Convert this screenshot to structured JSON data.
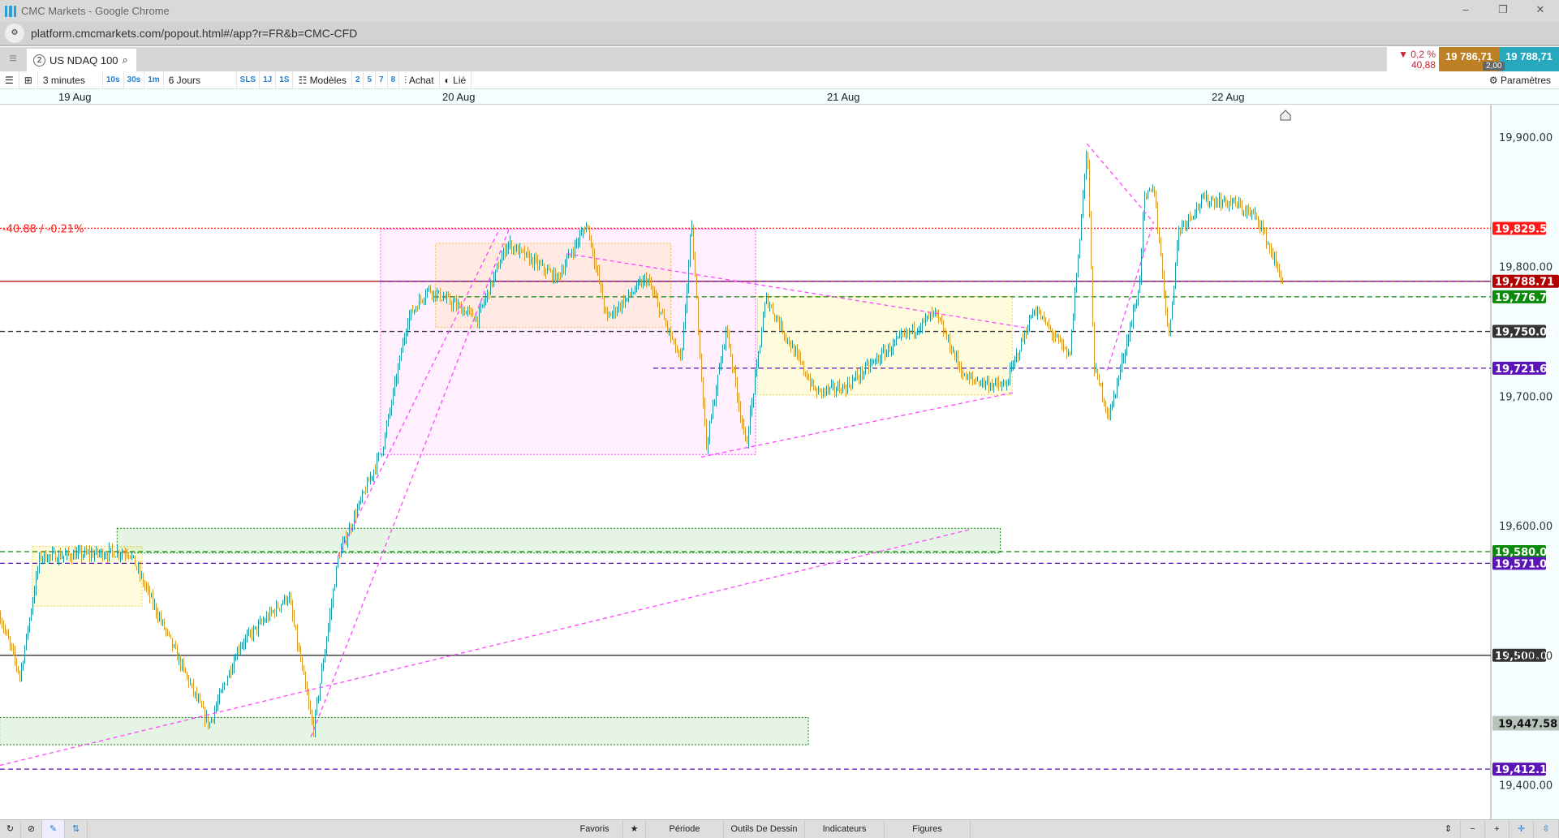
{
  "window": {
    "title": "CMC Markets - Google Chrome",
    "url": "platform.cmcmarkets.com/popout.html#/app?r=FR&b=CMC-CFD"
  },
  "tab": {
    "number": "2",
    "instrument": "US NDAQ 100"
  },
  "quote": {
    "change_pct": "▼ 0,2 %",
    "change_pts": "40,88",
    "sell": "19 786,71",
    "buy": "19 788,71",
    "spread": "2,00"
  },
  "toolbar": {
    "interval": "3 minutes",
    "quick_intervals": [
      "10s",
      "30s",
      "1m"
    ],
    "period": "6 Jours",
    "quick_periods": [
      "SLS",
      "1J",
      "1S"
    ],
    "templates": "Modèles",
    "template_slots": [
      "2",
      "5",
      "7",
      "8"
    ],
    "trade": "Achat",
    "linked": "Lié",
    "settings": "Paramètres"
  },
  "dates": [
    "19 Aug",
    "20 Aug",
    "21 Aug",
    "22 Aug"
  ],
  "bottom": {
    "favorites": "Favoris",
    "period": "Période",
    "drawing_tools": "Outils De Dessin",
    "indicators": "Indicateurs",
    "figures": "Figures"
  },
  "colors": {
    "up": "#1e9aa6",
    "down": "#d8982a",
    "accent": "#ff44ff"
  },
  "chart_data": {
    "type": "candlestick",
    "instrument": "US NDAQ 100",
    "timeframe": "3 minutes",
    "ylim": [
      19370,
      19925
    ],
    "x_unit": "days since 19 Aug (label)",
    "xlim": [
      -0.199,
      3.676
    ],
    "y_ticks": [
      "19,900.00",
      "19,800.00",
      "19,700.00",
      "19,600.00",
      "19,500.00",
      "19,400.00"
    ],
    "y_tick_values": [
      19900,
      19800,
      19700,
      19600,
      19500,
      19400
    ],
    "price_path": [
      [
        -0.199,
        19530
      ],
      [
        -0.147,
        19484
      ],
      [
        -0.096,
        19576
      ],
      [
        0.137,
        19580
      ],
      [
        0.189,
        19546
      ],
      [
        0.344,
        19446
      ],
      [
        0.422,
        19507
      ],
      [
        0.551,
        19546
      ],
      [
        0.615,
        19442
      ],
      [
        0.68,
        19576
      ],
      [
        0.796,
        19661
      ],
      [
        0.861,
        19760
      ],
      [
        0.913,
        19783
      ],
      [
        1.042,
        19760
      ],
      [
        1.12,
        19818
      ],
      [
        1.249,
        19791
      ],
      [
        1.327,
        19833
      ],
      [
        1.378,
        19760
      ],
      [
        1.482,
        19791
      ],
      [
        1.572,
        19726
      ],
      [
        1.598,
        19833
      ],
      [
        1.637,
        19661
      ],
      [
        1.689,
        19753
      ],
      [
        1.74,
        19661
      ],
      [
        1.792,
        19776
      ],
      [
        1.921,
        19703
      ],
      [
        1.999,
        19707
      ],
      [
        2.128,
        19741
      ],
      [
        2.232,
        19764
      ],
      [
        2.309,
        19714
      ],
      [
        2.413,
        19707
      ],
      [
        2.49,
        19768
      ],
      [
        2.581,
        19730
      ],
      [
        2.607,
        19822
      ],
      [
        2.627,
        19895
      ],
      [
        2.645,
        19722
      ],
      [
        2.684,
        19684
      ],
      [
        2.762,
        19783
      ],
      [
        2.775,
        19852
      ],
      [
        2.801,
        19860
      ],
      [
        2.839,
        19745
      ],
      [
        2.865,
        19829
      ],
      [
        2.93,
        19852
      ],
      [
        3.008,
        19849
      ],
      [
        3.072,
        19837
      ],
      [
        3.137,
        19787
      ]
    ],
    "levels": [
      {
        "value": 19829.59,
        "label": "19,829.59",
        "color": "#ff1a1a",
        "style": "dotted",
        "from": -0.199,
        "tag": "-40.88 / -0.21%"
      },
      {
        "value": 19788.71,
        "label": "19,788.71",
        "color": "#b00000",
        "style": "solid",
        "from": -0.199
      },
      {
        "value": 19788.71,
        "label": "",
        "color": "#5b14b8",
        "style": "dashed",
        "from": 0.79
      },
      {
        "value": 19776.71,
        "label": "19,776.71",
        "color": "#0a8a0a",
        "style": "dashed",
        "from": 0.93
      },
      {
        "value": 19750.0,
        "label": "19,750.00",
        "color": "#333333",
        "style": "dashed",
        "from": -0.199
      },
      {
        "value": 19721.62,
        "label": "19,721.62",
        "color": "#5b14b8",
        "style": "dashed",
        "from": 1.5
      },
      {
        "value": 19580.02,
        "label": "19,580.02",
        "color": "#0a8a0a",
        "style": "dashed",
        "from": -0.199
      },
      {
        "value": 19571.04,
        "label": "19,571.04",
        "color": "#5b14b8",
        "style": "dashed",
        "from": -0.199
      },
      {
        "value": 19500.0,
        "label": "19,500.00",
        "color": "#333333",
        "style": "solid",
        "from": -0.199
      },
      {
        "value": 19412.14,
        "label": "19,412.14",
        "color": "#5b14b8",
        "style": "dashed",
        "from": -0.199
      }
    ],
    "marker": {
      "value": 19447.58,
      "label": "19,447.58"
    },
    "zones": [
      {
        "t": [
          0.791,
          1.766
        ],
        "p": [
          19655,
          19829
        ],
        "color": "#ff44ff",
        "fill": "rgba(255,120,255,0.12)"
      },
      {
        "t": [
          0.934,
          1.546
        ],
        "p": [
          19753,
          19818
        ],
        "color": "#f0c040",
        "fill": "rgba(255,220,160,0.3)"
      },
      {
        "t": [
          1.771,
          2.433
        ],
        "p": [
          19701,
          19777
        ],
        "color": "#f0d040",
        "fill": "rgba(255,250,200,0.6)"
      },
      {
        "t": [
          -0.114,
          0.171
        ],
        "p": [
          19538,
          19584
        ],
        "color": "#f0d040",
        "fill": "rgba(255,250,200,0.6)"
      },
      {
        "t": [
          0.106,
          2.402
        ],
        "p": [
          19579,
          19598
        ],
        "color": "#0a8a0a",
        "fill": "rgba(60,170,60,0.13)"
      },
      {
        "t": [
          -0.199,
          1.903
        ],
        "p": [
          19431,
          19452
        ],
        "color": "#0a8a0a",
        "fill": "rgba(60,170,60,0.13)"
      }
    ],
    "trendlines": [
      [
        [
          -0.199,
          19415
        ],
        [
          2.322,
          19597
        ]
      ],
      [
        [
          0.61,
          19437
        ],
        [
          1.125,
          19829
        ]
      ],
      [
        [
          0.68,
          19576
        ],
        [
          1.1,
          19829
        ]
      ],
      [
        [
          1.275,
          19810
        ],
        [
          2.465,
          19753
        ]
      ],
      [
        [
          1.624,
          19653
        ],
        [
          2.439,
          19703
        ]
      ],
      [
        [
          2.68,
          19720
        ],
        [
          2.8,
          19834
        ]
      ],
      [
        [
          2.627,
          19895
        ],
        [
          2.801,
          19834
        ]
      ]
    ]
  }
}
